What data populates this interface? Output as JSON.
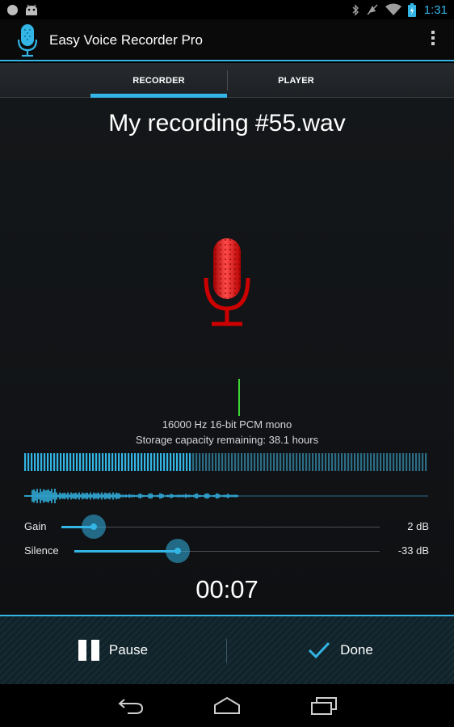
{
  "status_bar": {
    "time": "1:31",
    "icons": [
      "notification-dot-icon",
      "android-icon",
      "bluetooth-icon",
      "mute-icon",
      "wifi-icon",
      "battery-icon"
    ]
  },
  "action_bar": {
    "title": "Easy Voice Recorder Pro",
    "app_icon": "microphone-icon",
    "overflow_icon": "overflow-menu-icon"
  },
  "tabs": [
    {
      "label": "RECORDER",
      "selected": true
    },
    {
      "label": "PLAYER",
      "selected": false
    }
  ],
  "recording": {
    "file_name": "My recording #55.wav",
    "format": "16000 Hz 16-bit PCM mono",
    "storage": "Storage capacity remaining: 38.1 hours",
    "elapsed": "00:07",
    "mic_color": "#cc0000"
  },
  "sliders": {
    "gain": {
      "label": "Gain",
      "value": "2 dB",
      "fraction": 0.1
    },
    "silence": {
      "label": "Silence",
      "value": "-33 dB",
      "fraction": 0.34
    }
  },
  "controls": {
    "pause_label": "Pause",
    "done_label": "Done"
  },
  "nav": [
    "back-icon",
    "home-icon",
    "recent-apps-icon"
  ],
  "colors": {
    "accent": "#33b5e5",
    "playhead": "#3cd531",
    "mic": "#cc0000"
  }
}
